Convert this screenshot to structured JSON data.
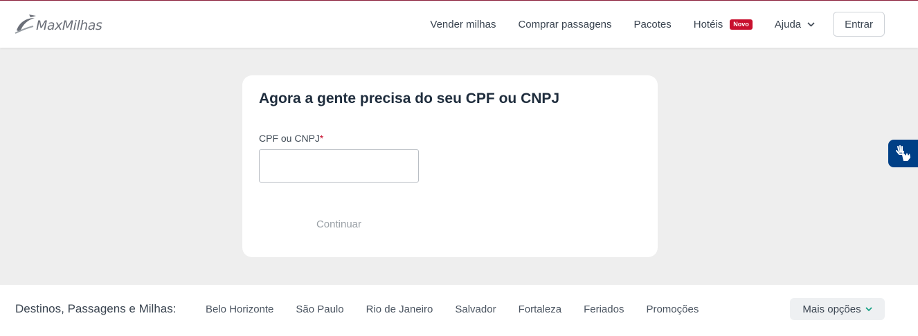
{
  "header": {
    "logo_text": "MaxMilhas",
    "nav": [
      {
        "label": "Vender milhas"
      },
      {
        "label": "Comprar passagens"
      },
      {
        "label": "Pacotes"
      },
      {
        "label": "Hotéis",
        "badge": "Novo"
      },
      {
        "label": "Ajuda",
        "icon": "chevron-down-icon"
      }
    ],
    "login_label": "Entrar"
  },
  "form": {
    "title": "Agora a gente precisa do seu CPF ou CNPJ",
    "field_label": "CPF ou CNPJ",
    "required_mark": "*",
    "field_value": "",
    "submit_label": "Continuar"
  },
  "accessibility": {
    "icon": "sign-language-hands-icon"
  },
  "footer": {
    "label": "Destinos, Passagens e Milhas:",
    "links": [
      "Belo Horizonte",
      "São Paulo",
      "Rio de Janeiro",
      "Salvador",
      "Fortaleza",
      "Feriados",
      "Promoções"
    ],
    "more_label": "Mais opções",
    "more_icon": "chevron-down-icon"
  },
  "colors": {
    "brand": "#8c1f3a",
    "badge": "#c8102e",
    "accessibility": "#003f86",
    "more_chevron": "#16a085",
    "page_background": "#eeeeee"
  }
}
